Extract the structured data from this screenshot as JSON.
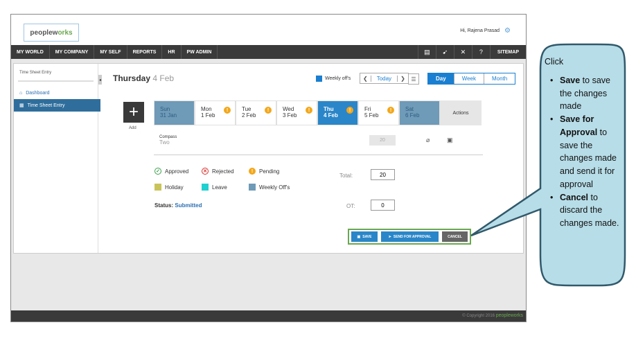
{
  "header": {
    "logo_main": "peoplew",
    "logo_accent": "orks",
    "greeting": "Hi, Rajena Prasad"
  },
  "navbar": {
    "items": [
      "MY WORLD",
      "MY COMPANY",
      "MY SELF",
      "REPORTS",
      "HR",
      "PW ADMIN"
    ],
    "sitemap": "SITEMAP"
  },
  "sidebar": {
    "title": "Time Sheet Entry",
    "items": [
      {
        "label": "Dashboard",
        "icon": "dashboard-icon"
      },
      {
        "label": "Time Sheet Entry",
        "icon": "timesheet-icon"
      }
    ]
  },
  "main": {
    "date_day": "Thursday",
    "date_sub": "4 Feb",
    "weekly_off_label": "Weekly off's",
    "today_label": "Today",
    "view_tabs": [
      "Day",
      "Week",
      "Month"
    ],
    "add_label": "Add",
    "days": [
      {
        "name": "Sun",
        "date": "31 Jan",
        "type": "weekend"
      },
      {
        "name": "Mon",
        "date": "1 Feb",
        "type": "pending"
      },
      {
        "name": "Tue",
        "date": "2 Feb",
        "type": "pending"
      },
      {
        "name": "Wed",
        "date": "3 Feb",
        "type": "pending"
      },
      {
        "name": "Thu",
        "date": "4 Feb",
        "type": "selected"
      },
      {
        "name": "Fri",
        "date": "5 Feb",
        "type": "pending"
      },
      {
        "name": "Sat",
        "date": "6 Feb",
        "type": "weekend"
      }
    ],
    "actions_label": "Actions",
    "project_name": "Compass",
    "project_sub": "Two",
    "project_hours": "20",
    "legend": {
      "approved": "Approved",
      "rejected": "Rejected",
      "pending": "Pending",
      "holiday": "Holiday",
      "leave": "Leave",
      "weekly_offs": "Weekly Off's"
    },
    "status_label": "Status:",
    "status_value": "Submitted",
    "total_label": "Total:",
    "total_value": "20",
    "ot_label": "OT:",
    "ot_value": "0",
    "buttons": {
      "save": "SAVE",
      "send": "SEND FOR APPROVAL",
      "cancel": "CANCEL"
    }
  },
  "footer": {
    "copyright": "© Copyright 2016",
    "logo_main": "peoplew",
    "logo_accent": "orks"
  },
  "callout": {
    "intro": "Click",
    "items": [
      {
        "bold": "Save",
        "text": " to save the changes made"
      },
      {
        "bold": "Save for Approval",
        "text": " to save the changes made and send it for approval"
      },
      {
        "bold": "Cancel",
        "text": " to discard the changes made."
      }
    ]
  },
  "colors": {
    "accent": "#2a86c8",
    "nav_bg": "#3a3a3a",
    "callout_fill": "#b7dde8",
    "callout_border": "#31596b",
    "button_highlight": "#6aa84f"
  }
}
